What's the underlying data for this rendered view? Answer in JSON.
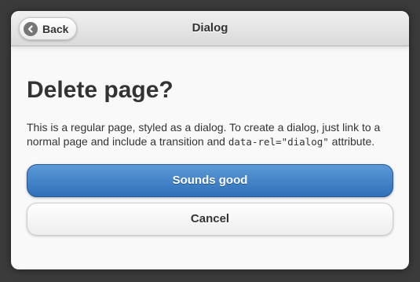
{
  "header": {
    "title": "Dialog",
    "back_label": "Back",
    "back_icon": "arrow-left-icon"
  },
  "content": {
    "heading": "Delete page?",
    "description_pre": "This is a regular page, styled as a dialog. To create a dialog, just link to a normal page and include a transition and ",
    "description_code": "data-rel=\"dialog\"",
    "description_post": " attribute."
  },
  "buttons": {
    "primary_label": "Sounds good",
    "secondary_label": "Cancel"
  },
  "colors": {
    "primary_button": "#3e81c8",
    "page_background": "#3b3b3b",
    "dialog_background": "#f9f9f9"
  }
}
